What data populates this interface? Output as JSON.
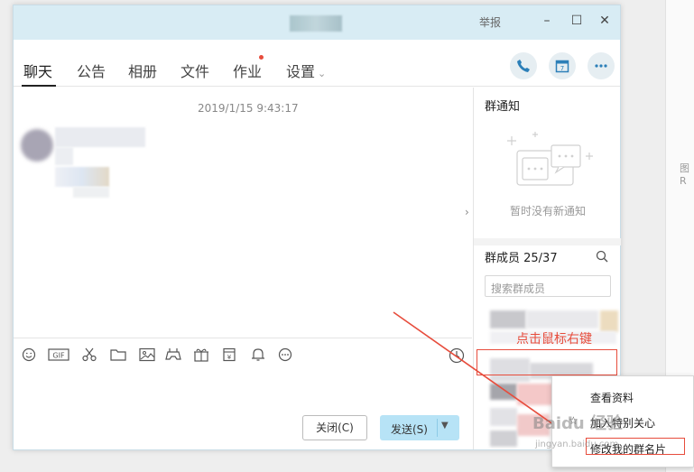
{
  "titlebar": {
    "report_label": "举报",
    "min_symbol": "–",
    "max_symbol": "☐",
    "close_symbol": "✕"
  },
  "tabs": [
    {
      "label": "聊天"
    },
    {
      "label": "公告"
    },
    {
      "label": "相册"
    },
    {
      "label": "文件"
    },
    {
      "label": "作业"
    },
    {
      "label": "设置"
    }
  ],
  "chat": {
    "timestamp": "2019/1/15 9:43:17"
  },
  "toolbar": {
    "icons": [
      "emoji-icon",
      "gif-icon",
      "scissors-icon",
      "folder-icon",
      "image-icon",
      "gamepad-icon",
      "gift-icon",
      "red-packet-icon",
      "bell-icon",
      "more-icon"
    ],
    "gif_label": "GIF"
  },
  "buttons": {
    "close_label": "关闭(C)",
    "send_label": "发送(S)"
  },
  "right_panel": {
    "notice_title": "群通知",
    "notice_empty": "暂时没有新通知",
    "members_title": "群成员 25/37",
    "search_placeholder": "搜索群成员"
  },
  "annotation": {
    "text": "点击鼠标右键",
    "color": "#e74c3c"
  },
  "context_menu": {
    "items": [
      "查看资料",
      "加入特别关心",
      "修改我的群名片"
    ]
  },
  "watermark": {
    "text": "Baidu 经验",
    "sub": "jingyan.baidu.com"
  },
  "side_right": {
    "text": "图R"
  }
}
